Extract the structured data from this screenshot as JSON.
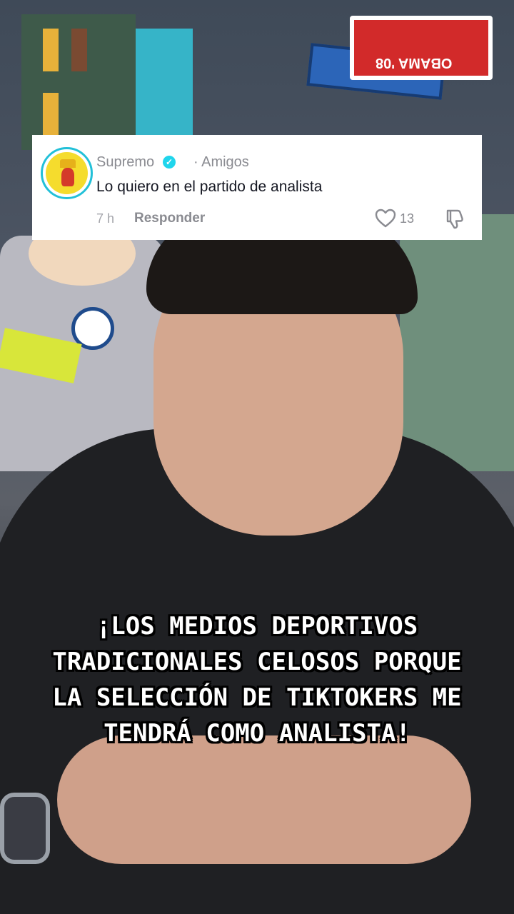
{
  "background": {
    "sign_text": "OBAMA '08"
  },
  "comment": {
    "username": "Supremo",
    "verified": true,
    "relationship": "· Amigos",
    "text": "Lo quiero en el partido de analista",
    "time": "7 h",
    "reply_label": "Responder",
    "like_count": "13",
    "icons": {
      "avatar": "crowned-character-avatar",
      "verified": "verified-badge-icon",
      "like": "heart-outline-icon",
      "dislike": "thumbs-down-icon"
    }
  },
  "caption": {
    "lines": [
      "¡LOS MEDIOS DEPORTIVOS",
      "TRADICIONALES CELOSOS PORQUE",
      "LA SELECCIÓN DE TIKTOKERS ME",
      "TENDRÁ COMO ANALISTA!"
    ]
  },
  "colors": {
    "verified": "#20d5ec",
    "avatar_ring": "#22c0d8",
    "card_bg": "#ffffff",
    "caption_text": "#ffffff",
    "caption_outline": "#000000"
  }
}
